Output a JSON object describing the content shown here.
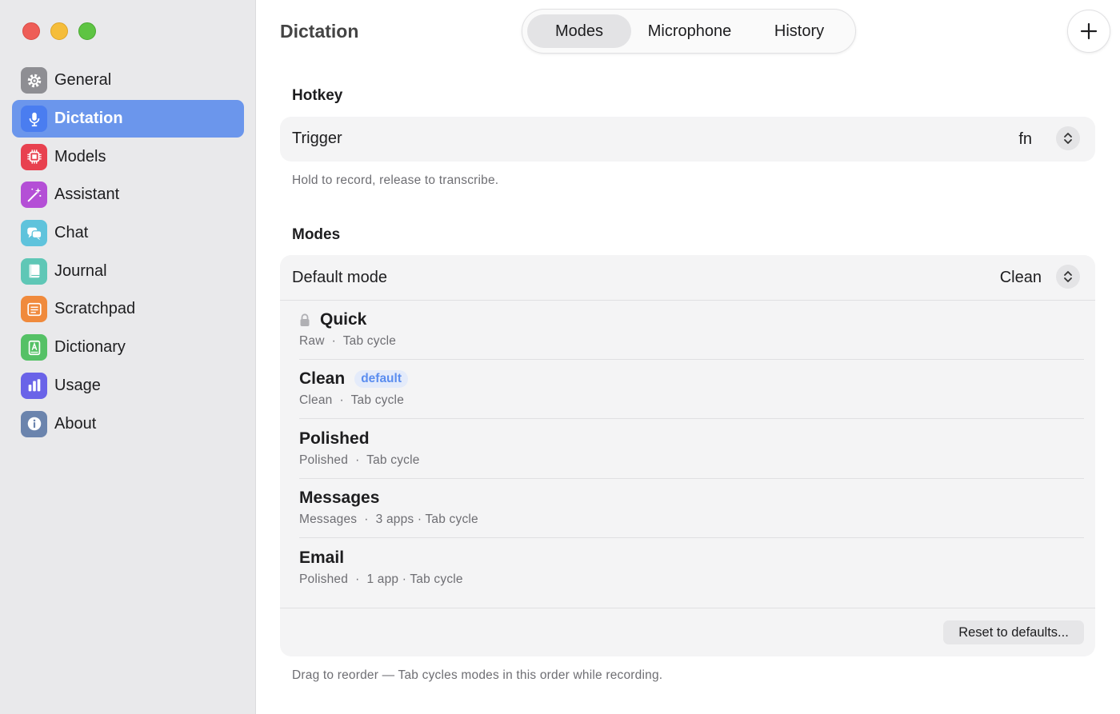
{
  "sidebar": {
    "items": [
      {
        "label": "General",
        "icon": "gear-icon",
        "color": "#8e8e93"
      },
      {
        "label": "Dictation",
        "icon": "microphone-icon",
        "color": "#4a7df0"
      },
      {
        "label": "Models",
        "icon": "chip-icon",
        "color": "#e8414f"
      },
      {
        "label": "Assistant",
        "icon": "magic-wand-icon",
        "color": "#b44fd6"
      },
      {
        "label": "Chat",
        "icon": "chat-bubbles-icon",
        "color": "#5fc3dc"
      },
      {
        "label": "Journal",
        "icon": "book-icon",
        "color": "#5fc7b6"
      },
      {
        "label": "Scratchpad",
        "icon": "notepad-icon",
        "color": "#f08a3c"
      },
      {
        "label": "Dictionary",
        "icon": "dictionary-icon",
        "color": "#55c166"
      },
      {
        "label": "Usage",
        "icon": "bar-chart-icon",
        "color": "#6a63e8"
      },
      {
        "label": "About",
        "icon": "info-icon",
        "color": "#6b84ad"
      }
    ],
    "active_index": 1
  },
  "header": {
    "title": "Dictation",
    "tabs": [
      "Modes",
      "Microphone",
      "History"
    ],
    "active_tab": "Modes"
  },
  "hotkey": {
    "section_label": "Hotkey",
    "trigger_label": "Trigger",
    "trigger_value": "fn",
    "hint": "Hold to record, release to transcribe."
  },
  "modes": {
    "section_label": "Modes",
    "default_mode_label": "Default mode",
    "default_mode_value": "Clean",
    "items": [
      {
        "name": "Quick",
        "subtitle": "Raw  ·  Tab cycle",
        "locked": true
      },
      {
        "name": "Clean",
        "subtitle": "Clean  ·  Tab cycle",
        "badge": "default"
      },
      {
        "name": "Polished",
        "subtitle": "Polished  ·  Tab cycle"
      },
      {
        "name": "Messages",
        "subtitle": "Messages  ·  3 apps · Tab cycle"
      },
      {
        "name": "Email",
        "subtitle": "Polished  ·  1 app · Tab cycle"
      }
    ],
    "reset_label": "Reset to defaults...",
    "footer_hint": "Drag to reorder — Tab cycles modes in this order while recording."
  },
  "colors": {
    "accent": "#6b96ec",
    "sidebar_bg": "#e9e9eb",
    "card_bg": "#f4f4f5",
    "badge_text": "#5b8def"
  }
}
